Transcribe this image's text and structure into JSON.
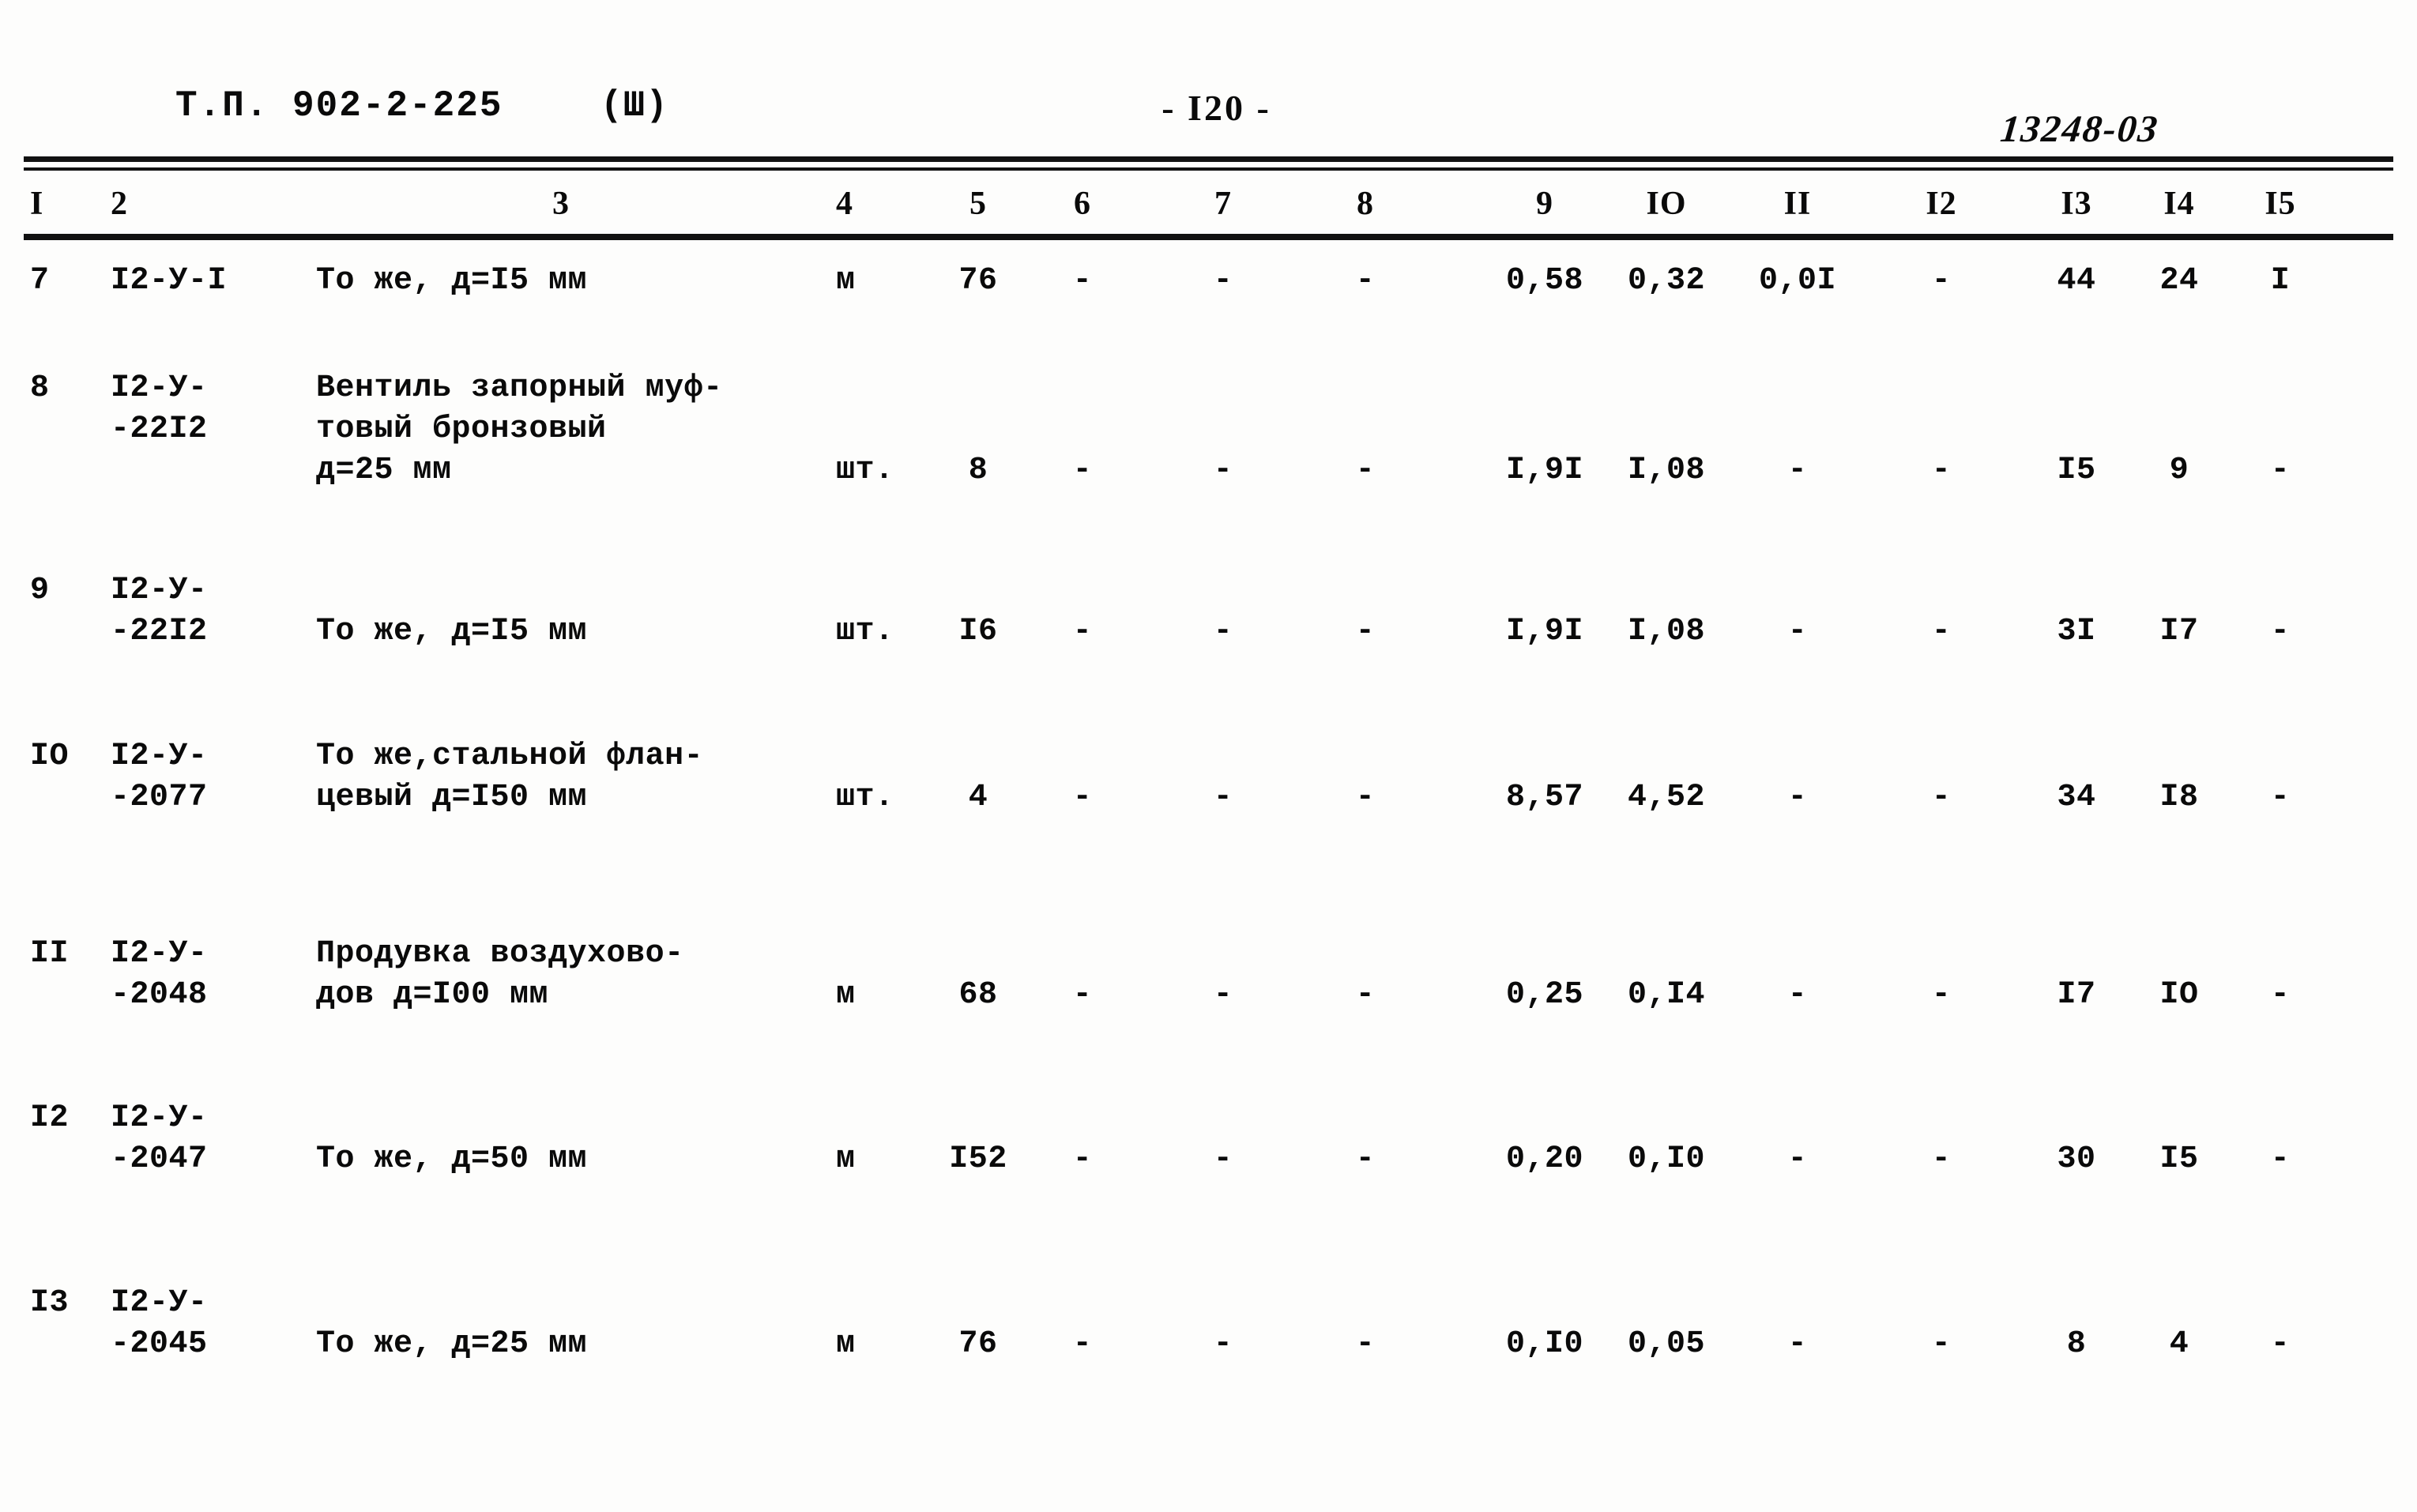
{
  "header": {
    "doc_code": "Т.П. 902-2-225",
    "part": "(Ш)",
    "page_number": "- I20 -",
    "archive_code": "13248-03"
  },
  "table": {
    "column_numbers": [
      "I",
      "2",
      "3",
      "4",
      "5",
      "6",
      "7",
      "8",
      "9",
      "IO",
      "II",
      "I2",
      "I3",
      "I4",
      "I5"
    ],
    "rows": [
      {
        "num": "7",
        "code": "I2-У-I",
        "code2": "",
        "desc1": "То же, д=I5 мм",
        "desc2": "",
        "desc3": "",
        "unit": "м",
        "qty": "76",
        "c6": "-",
        "c7": "-",
        "c8": "-",
        "c9": "0,58",
        "c10": "0,32",
        "c11": "0,0I",
        "c12": "-",
        "c13": "44",
        "c14": "24",
        "c15": "I"
      },
      {
        "num": "8",
        "code": "I2-У-",
        "code2": "-22I2",
        "desc1": "Вентиль запорный муф-",
        "desc2": "товый бронзовый",
        "desc3": "д=25 мм",
        "unit": "шт.",
        "qty": "8",
        "c6": "-",
        "c7": "-",
        "c8": "-",
        "c9": "I,9I",
        "c10": "I,08",
        "c11": "-",
        "c12": "-",
        "c13": "I5",
        "c14": "9",
        "c15": "-"
      },
      {
        "num": "9",
        "code": "I2-У-",
        "code2": "-22I2",
        "desc1": "",
        "desc2": "То же, д=I5 мм",
        "desc3": "",
        "unit": "шт.",
        "qty": "I6",
        "c6": "-",
        "c7": "-",
        "c8": "-",
        "c9": "I,9I",
        "c10": "I,08",
        "c11": "-",
        "c12": "-",
        "c13": "3I",
        "c14": "I7",
        "c15": "-"
      },
      {
        "num": "IO",
        "code": "I2-У-",
        "code2": "-2077",
        "desc1": "То же,стальной флан-",
        "desc2": "цевый д=I50 мм",
        "desc3": "",
        "unit": "шт.",
        "qty": "4",
        "c6": "-",
        "c7": "-",
        "c8": "-",
        "c9": "8,57",
        "c10": "4,52",
        "c11": "-",
        "c12": "-",
        "c13": "34",
        "c14": "I8",
        "c15": "-"
      },
      {
        "num": "II",
        "code": "I2-У-",
        "code2": "-2048",
        "desc1": "Продувка воздухово-",
        "desc2": "дов д=I00 мм",
        "desc3": "",
        "unit": "м",
        "qty": "68",
        "c6": "-",
        "c7": "-",
        "c8": "-",
        "c9": "0,25",
        "c10": "0,I4",
        "c11": "-",
        "c12": "-",
        "c13": "I7",
        "c14": "IO",
        "c15": "-"
      },
      {
        "num": "I2",
        "code": "I2-У-",
        "code2": "-2047",
        "desc1": "",
        "desc2": "То же, д=50 мм",
        "desc3": "",
        "unit": "м",
        "qty": "I52",
        "c6": "-",
        "c7": "-",
        "c8": "-",
        "c9": "0,20",
        "c10": "0,I0",
        "c11": "-",
        "c12": "-",
        "c13": "30",
        "c14": "I5",
        "c15": "-"
      },
      {
        "num": "I3",
        "code": "I2-У-",
        "code2": "-2045",
        "desc1": "",
        "desc2": "То же, д=25 мм",
        "desc3": "",
        "unit": "м",
        "qty": "76",
        "c6": "-",
        "c7": "-",
        "c8": "-",
        "c9": "0,I0",
        "c10": "0,05",
        "c11": "-",
        "c12": "-",
        "c13": "8",
        "c14": "4",
        "c15": "-"
      }
    ]
  }
}
